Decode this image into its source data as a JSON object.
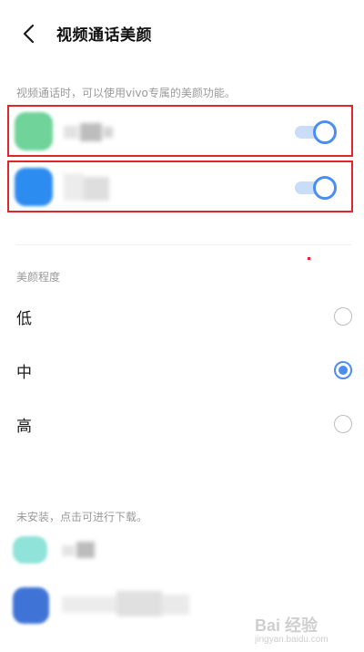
{
  "header": {
    "title": "视频通话美颜",
    "back_icon": "chevron-left-icon"
  },
  "intro_text": "视频通话时，可以使用vivo专属的美颜功能。",
  "apps": [
    {
      "name": "",
      "icon_color": "#6fd39a",
      "enabled": true
    },
    {
      "name": "",
      "icon_color": "#2d8cf0",
      "enabled": true
    }
  ],
  "level_section": {
    "label": "美颜程度",
    "options": [
      {
        "label": "低",
        "selected": false
      },
      {
        "label": "中",
        "selected": true
      },
      {
        "label": "高",
        "selected": false
      }
    ]
  },
  "install_section": {
    "label": "未安装，点击可进行下载。",
    "apps": [
      {
        "name": "",
        "icon_color": "#8fe3d8"
      },
      {
        "name": "",
        "icon_color": "#3f73d6"
      }
    ]
  },
  "watermark": {
    "text": "Bai 经验",
    "sub": "jingyan.baidu.com"
  },
  "colors": {
    "accent": "#4b8df0",
    "highlight_box": "#e0252b"
  }
}
